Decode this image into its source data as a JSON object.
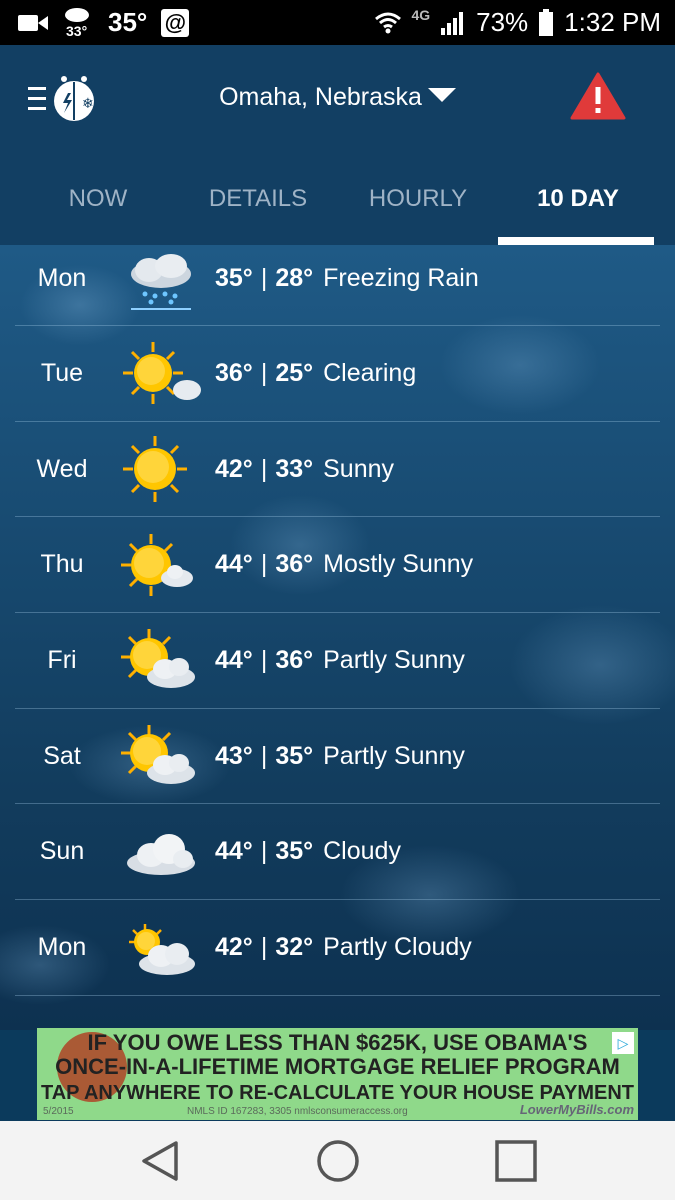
{
  "status_bar": {
    "temp_small": "33°",
    "temp_big": "35°",
    "at_icon": "@",
    "network": "4G",
    "battery": "73%",
    "time": "1:32 PM"
  },
  "header": {
    "location": "Omaha, Nebraska"
  },
  "tabs": [
    {
      "label": "NOW",
      "active": false
    },
    {
      "label": "DETAILS",
      "active": false
    },
    {
      "label": "HOURLY",
      "active": false
    },
    {
      "label": "10 DAY",
      "active": true
    }
  ],
  "forecast": [
    {
      "day": "Mon",
      "high": "35°",
      "low": "28°",
      "condition": "Freezing Rain",
      "icon": "freezing-rain-icon"
    },
    {
      "day": "Tue",
      "high": "36°",
      "low": "25°",
      "condition": "Clearing",
      "icon": "clearing-icon"
    },
    {
      "day": "Wed",
      "high": "42°",
      "low": "33°",
      "condition": "Sunny",
      "icon": "sunny-icon"
    },
    {
      "day": "Thu",
      "high": "44°",
      "low": "36°",
      "condition": "Mostly Sunny",
      "icon": "mostly-sunny-icon"
    },
    {
      "day": "Fri",
      "high": "44°",
      "low": "36°",
      "condition": "Partly Sunny",
      "icon": "partly-sunny-icon"
    },
    {
      "day": "Sat",
      "high": "43°",
      "low": "35°",
      "condition": "Partly Sunny",
      "icon": "partly-sunny-icon"
    },
    {
      "day": "Sun",
      "high": "44°",
      "low": "35°",
      "condition": "Cloudy",
      "icon": "cloudy-icon"
    },
    {
      "day": "Mon",
      "high": "42°",
      "low": "32°",
      "condition": "Partly Cloudy",
      "icon": "partly-cloudy-icon"
    }
  ],
  "ad": {
    "line1": "IF YOU OWE LESS THAN $625K, USE OBAMA'S",
    "line2": "ONCE-IN-A-LIFETIME MORTGAGE RELIEF PROGRAM",
    "line3": "TAP ANYWHERE TO RE-CALCULATE YOUR HOUSE PAYMENT",
    "fine_left": "5/2015",
    "fine": "NMLS ID 167283, 3305  nmlsconsumeraccess.org",
    "brand": "LowerMyBills.com"
  },
  "colors": {
    "header_bg": "#123f63",
    "alert_red": "#e03a3a",
    "sun_yellow": "#ffc600"
  }
}
